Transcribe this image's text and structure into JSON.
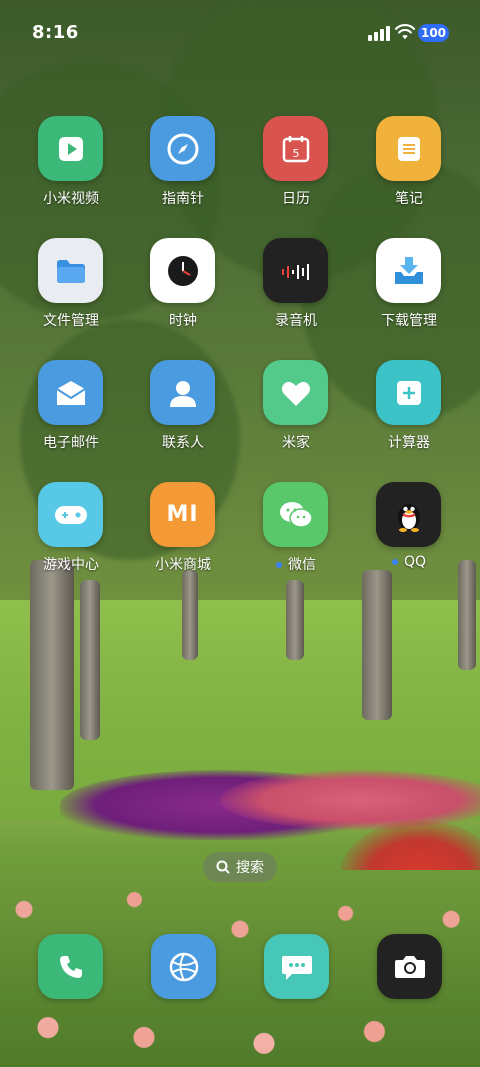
{
  "status_bar": {
    "time": "8:16",
    "battery": "100",
    "battery_color": "#2f6df6"
  },
  "apps": [
    {
      "label": "小米视频",
      "icon": "video-play-icon",
      "color": "#3cb878"
    },
    {
      "label": "指南针",
      "icon": "compass-icon",
      "color": "#4a9be0"
    },
    {
      "label": "日历",
      "icon": "calendar-icon",
      "color": "#d9534f",
      "icon_text": "5"
    },
    {
      "label": "笔记",
      "icon": "notes-icon",
      "color": "#f0b23a"
    },
    {
      "label": "文件管理",
      "icon": "folder-icon",
      "color": "#e9edf2"
    },
    {
      "label": "时钟",
      "icon": "clock-icon",
      "color": "#ffffff"
    },
    {
      "label": "录音机",
      "icon": "recorder-icon",
      "color": "#222222"
    },
    {
      "label": "下载管理",
      "icon": "download-icon",
      "color": "#ffffff"
    },
    {
      "label": "电子邮件",
      "icon": "mail-icon",
      "color": "#4a9be0"
    },
    {
      "label": "联系人",
      "icon": "contact-icon",
      "color": "#4a9be0"
    },
    {
      "label": "米家",
      "icon": "heart-icon",
      "color": "#53c98a"
    },
    {
      "label": "计算器",
      "icon": "calculator-icon",
      "color": "#3cc3c8"
    },
    {
      "label": "游戏中心",
      "icon": "game-controller-icon",
      "color": "#57c8e6"
    },
    {
      "label": "小米商城",
      "icon": "mi-logo-icon",
      "color": "#f39a36",
      "icon_text": "MI"
    },
    {
      "label": "微信",
      "icon": "wechat-icon",
      "color": "#58c86a"
    },
    {
      "label": "QQ",
      "icon": "qq-penguin-icon",
      "color": "#222222"
    }
  ],
  "search": {
    "label": "搜索"
  },
  "dock": [
    {
      "icon": "phone-icon",
      "color": "#3cb878"
    },
    {
      "icon": "browser-icon",
      "color": "#4a9be0"
    },
    {
      "icon": "messages-icon",
      "color": "#46c7b8"
    },
    {
      "icon": "camera-icon",
      "color": "#222222"
    }
  ]
}
